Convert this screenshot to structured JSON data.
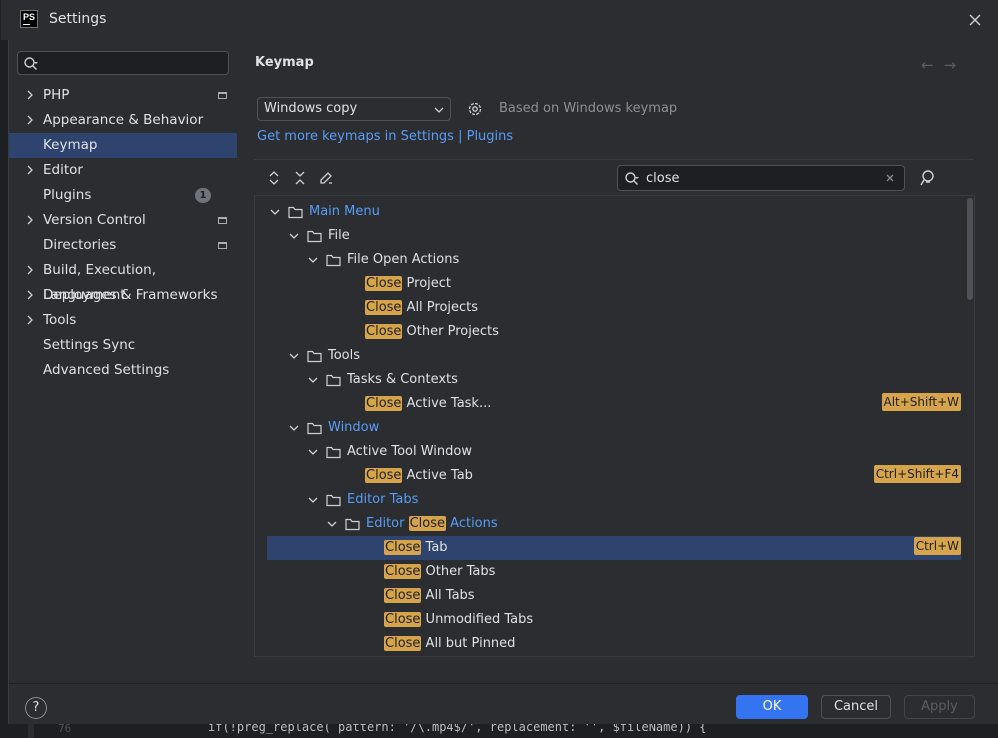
{
  "window": {
    "title": "Settings",
    "logo_text": "PS"
  },
  "sidebar": {
    "search_placeholder": "",
    "items": [
      {
        "label": "PHP",
        "expandable": true,
        "pinned": true
      },
      {
        "label": "Appearance & Behavior",
        "expandable": true
      },
      {
        "label": "Keymap",
        "selected": true
      },
      {
        "label": "Editor",
        "expandable": true
      },
      {
        "label": "Plugins",
        "badge": "1"
      },
      {
        "label": "Version Control",
        "expandable": true,
        "pinned": true
      },
      {
        "label": "Directories",
        "pinned": true
      },
      {
        "label": "Build, Execution, Deployment",
        "expandable": true
      },
      {
        "label": "Languages & Frameworks",
        "expandable": true
      },
      {
        "label": "Tools",
        "expandable": true
      },
      {
        "label": "Settings Sync"
      },
      {
        "label": "Advanced Settings"
      }
    ]
  },
  "panel": {
    "title": "Keymap",
    "back_arrow": "←",
    "forward_arrow": "→",
    "keymap_selected": "Windows copy",
    "based_on": "Based on Windows keymap",
    "more_link": "Get more keymaps in Settings | Plugins",
    "filter_value": "close"
  },
  "tree": [
    {
      "indent": 0,
      "arrow": true,
      "folder": true,
      "segments": [
        [
          "Main Menu",
          false
        ]
      ],
      "blue": true
    },
    {
      "indent": 1,
      "arrow": true,
      "folder": true,
      "segments": [
        [
          "File",
          false
        ]
      ]
    },
    {
      "indent": 2,
      "arrow": true,
      "folder": true,
      "segments": [
        [
          "File Open Actions",
          false
        ]
      ]
    },
    {
      "indent": 4,
      "segments": [
        [
          "Close",
          true
        ],
        [
          " Project",
          false
        ]
      ]
    },
    {
      "indent": 4,
      "segments": [
        [
          "Close",
          true
        ],
        [
          " All Projects",
          false
        ]
      ]
    },
    {
      "indent": 4,
      "segments": [
        [
          "Close",
          true
        ],
        [
          " Other Projects",
          false
        ]
      ]
    },
    {
      "indent": 1,
      "arrow": true,
      "folder": true,
      "segments": [
        [
          "Tools",
          false
        ]
      ]
    },
    {
      "indent": 2,
      "arrow": true,
      "folder": true,
      "segments": [
        [
          "Tasks & Contexts",
          false
        ]
      ]
    },
    {
      "indent": 4,
      "segments": [
        [
          "Close",
          true
        ],
        [
          " Active Task...",
          false
        ]
      ],
      "shortcut": "Alt+Shift+W"
    },
    {
      "indent": 1,
      "arrow": true,
      "folder": true,
      "segments": [
        [
          "Window",
          false
        ]
      ],
      "blue": true
    },
    {
      "indent": 2,
      "arrow": true,
      "folder": true,
      "segments": [
        [
          "Active Tool Window",
          false
        ]
      ]
    },
    {
      "indent": 4,
      "segments": [
        [
          "Close",
          true
        ],
        [
          " Active Tab",
          false
        ]
      ],
      "shortcut": "Ctrl+Shift+F4"
    },
    {
      "indent": 2,
      "arrow": true,
      "folder": true,
      "segments": [
        [
          "Editor Tabs",
          false
        ]
      ],
      "blue": true
    },
    {
      "indent": 3,
      "arrow": true,
      "folder": true,
      "segments": [
        [
          "Editor ",
          false
        ],
        [
          "Close",
          true
        ],
        [
          " Actions",
          false
        ]
      ],
      "blue": true
    },
    {
      "indent": 5,
      "segments": [
        [
          "Close",
          true
        ],
        [
          " Tab",
          false
        ]
      ],
      "shortcut": "Ctrl+W",
      "selected": true
    },
    {
      "indent": 5,
      "segments": [
        [
          "Close",
          true
        ],
        [
          " Other Tabs",
          false
        ]
      ]
    },
    {
      "indent": 5,
      "segments": [
        [
          "Close",
          true
        ],
        [
          " All Tabs",
          false
        ]
      ]
    },
    {
      "indent": 5,
      "segments": [
        [
          "Close",
          true
        ],
        [
          " Unmodified Tabs",
          false
        ]
      ]
    },
    {
      "indent": 5,
      "segments": [
        [
          "Close",
          true
        ],
        [
          " All but Pinned",
          false
        ]
      ]
    }
  ],
  "buttons": {
    "ok": "OK",
    "cancel": "Cancel",
    "apply": "Apply",
    "help": "?"
  },
  "editor_behind": {
    "line_number": "76",
    "code": "if(!preg_replace( pattern: '/\\.mp4$/', replacement: '', $fileName)) {"
  },
  "colors": {
    "accent": "#3574f0",
    "selection": "#2e436e",
    "highlight": "#d6a44a",
    "link": "#589df6"
  }
}
